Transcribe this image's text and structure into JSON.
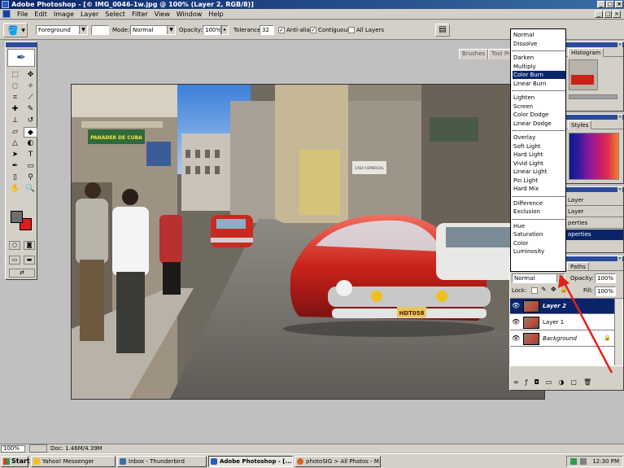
{
  "window": {
    "title": "Adobe Photoshop - [© IMG_0046-1w.jpg @ 100% (Layer 2, RGB/8)]",
    "btn_min": "_",
    "btn_max": "□",
    "btn_close": "×"
  },
  "menu": [
    "File",
    "Edit",
    "Image",
    "Layer",
    "Select",
    "Filter",
    "View",
    "Window",
    "Help"
  ],
  "options": {
    "fill_source": "Foreground",
    "mode_label": "Mode:",
    "mode_value": "Normal",
    "opacity_label": "Opacity:",
    "opacity_value": "100%",
    "tolerance_label": "Tolerance:",
    "tolerance_value": "32",
    "antialias_label": "Anti-alias",
    "contiguous_label": "Contiguous",
    "all_layers_label": "All Layers",
    "check_mark": "✓"
  },
  "palette_well": {
    "tabs": [
      "Brushes",
      "Tool Pre"
    ]
  },
  "palettes": {
    "navigator_tab": "Histogram",
    "styles_tab": "Styles",
    "history_tabs": [
      "Layer",
      "Layer",
      "perties"
    ],
    "history_selected": "operties",
    "layers_tab": "Paths",
    "opacity_label": "Opacity:",
    "opacity_value": "100%",
    "lock_label": "Lock:",
    "fill_label": "Fill:",
    "fill_value": "100%",
    "blend_value": "Normal",
    "layers": [
      "Layer 2",
      "Layer 1",
      "Background"
    ]
  },
  "blend_modes": {
    "groups": [
      [
        "Normal",
        "Dissolve"
      ],
      [
        "Darken",
        "Multiply",
        "Color Burn",
        "Linear Burn"
      ],
      [
        "Lighten",
        "Screen",
        "Color Dodge",
        "Linear Dodge"
      ],
      [
        "Overlay",
        "Soft Light",
        "Hard Light",
        "Vivid Light",
        "Linear Light",
        "Pin Light",
        "Hard Mix"
      ],
      [
        "Difference",
        "Exclusion"
      ],
      [
        "Hue",
        "Saturation",
        "Color",
        "Luminosity"
      ]
    ],
    "selected": "Color Burn"
  },
  "photo_signs": {
    "shop_sign": "PANADER DE CUBA",
    "store_sign": "CASA COMERCIAL",
    "plate": "HDT058"
  },
  "status": {
    "zoom": "100%",
    "doc_info": "Doc: 1.46M/4.39M"
  },
  "taskbar": {
    "start": "Start",
    "tasks": [
      "Yahoo! Messenger",
      "Inbox - Thunderbird",
      "Adobe Photoshop - [...",
      "photoSIG > All Photos - M..."
    ],
    "active_task": "Adobe Photoshop - [...",
    "clock": "12:30 PM"
  },
  "colors": {
    "foreground": "#6e6e6e",
    "background": "#e01c1c",
    "selection": "#0a246a",
    "annotation_arrow": "#e0241c"
  }
}
